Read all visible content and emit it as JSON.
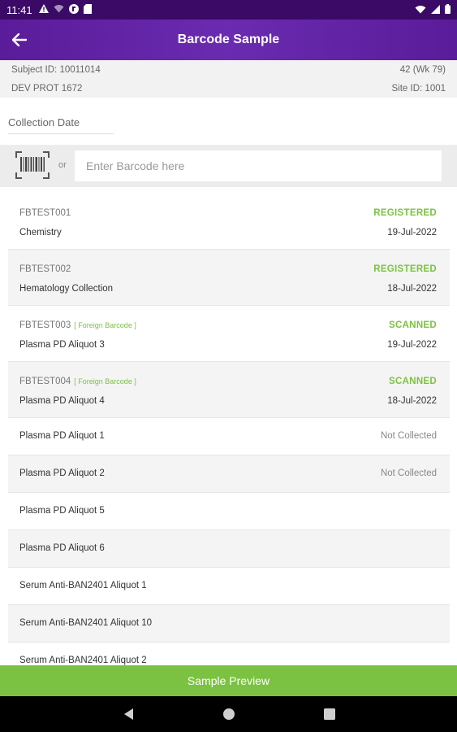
{
  "status_bar": {
    "time": "11:41",
    "icons_left": [
      "alert-icon",
      "wifi-off-icon",
      "app-badge-icon",
      "sd-card-icon"
    ],
    "icons_right": [
      "wifi-icon",
      "signal-icon",
      "battery-icon"
    ]
  },
  "header": {
    "title": "Barcode Sample"
  },
  "subject": {
    "subject_id": "Subject ID: 10011014",
    "visit": "42 (Wk 79)",
    "protocol": "DEV PROT 1672",
    "site_id": "Site ID: 1001"
  },
  "collection": {
    "label": "Collection Date"
  },
  "barcode": {
    "or_label": "or",
    "placeholder": "Enter Barcode here"
  },
  "samples": [
    {
      "code": "FBTEST001",
      "foreign": "",
      "name": "Chemistry",
      "status": "REGISTERED",
      "date": "19-Jul-2022"
    },
    {
      "code": "FBTEST002",
      "foreign": "",
      "name": "Hematology Collection",
      "status": "REGISTERED",
      "date": "18-Jul-2022"
    },
    {
      "code": "FBTEST003",
      "foreign": "[ Foreign Barcode ]",
      "name": "Plasma PD Aliquot 3",
      "status": "SCANNED",
      "date": "19-Jul-2022"
    },
    {
      "code": "FBTEST004",
      "foreign": "[ Foreign Barcode ]",
      "name": "Plasma PD Aliquot 4",
      "status": "SCANNED",
      "date": "18-Jul-2022"
    },
    {
      "name": "Plasma PD Aliquot 1",
      "status": "Not Collected"
    },
    {
      "name": "Plasma PD Aliquot 2",
      "status": "Not Collected"
    },
    {
      "name": "Plasma PD Aliquot 5",
      "status": ""
    },
    {
      "name": "Plasma PD Aliquot 6",
      "status": ""
    },
    {
      "name": "Serum Anti-BAN2401 Aliquot 1",
      "status": ""
    },
    {
      "name": "Serum Anti-BAN2401 Aliquot 10",
      "status": ""
    },
    {
      "name": "Serum Anti-BAN2401 Aliquot 2",
      "status": ""
    }
  ],
  "footer": {
    "preview_label": "Sample Preview"
  },
  "colors": {
    "purple": "#5a1c99",
    "status_green": "#7cc242"
  }
}
